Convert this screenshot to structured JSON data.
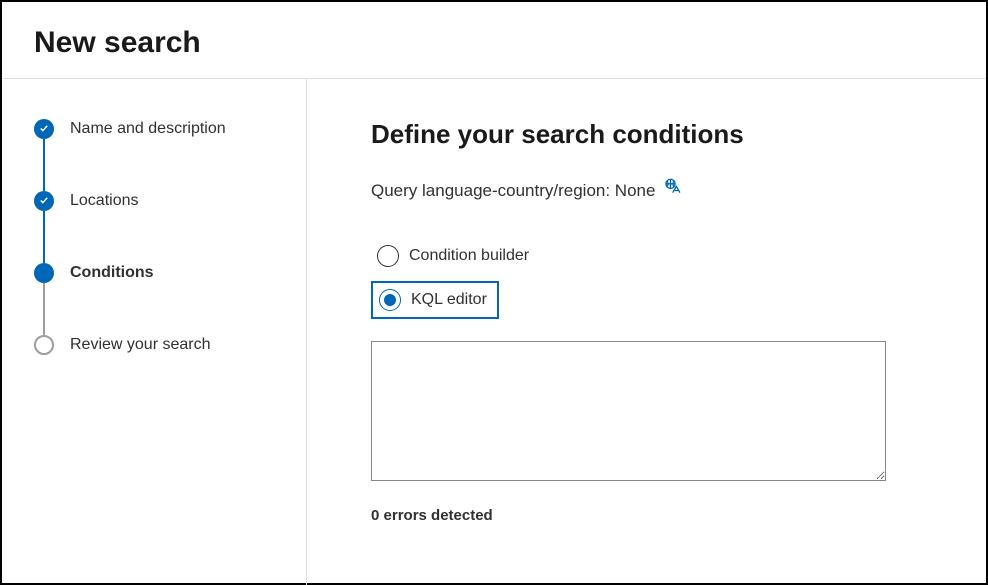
{
  "header": {
    "title": "New search"
  },
  "sidebar": {
    "steps": [
      {
        "label": "Name and description",
        "state": "completed"
      },
      {
        "label": "Locations",
        "state": "completed"
      },
      {
        "label": "Conditions",
        "state": "current"
      },
      {
        "label": "Review your search",
        "state": "upcoming"
      }
    ]
  },
  "main": {
    "title": "Define your search conditions",
    "query_language_label": "Query language-country/region: None",
    "options": {
      "condition_builder": "Condition builder",
      "kql_editor": "KQL editor",
      "selected": "kql_editor"
    },
    "editor_value": "",
    "errors_text": "0 errors detected"
  }
}
